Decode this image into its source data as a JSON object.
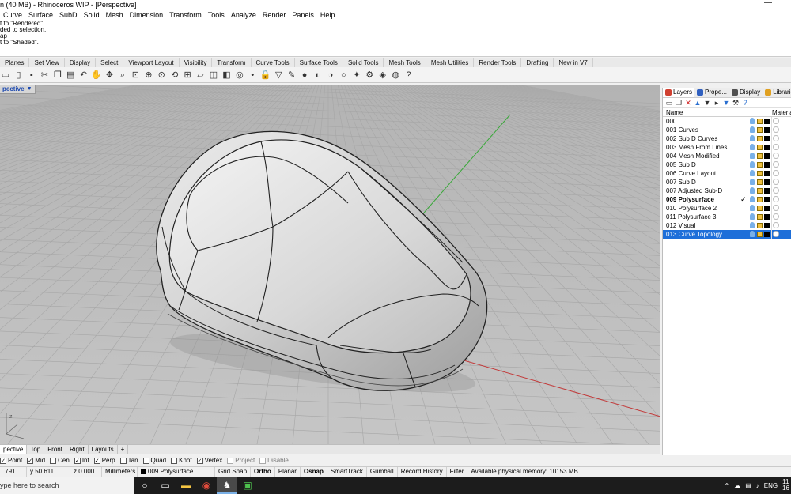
{
  "window": {
    "title": "n (40 MB) - Rhinoceros WIP - [Perspective]",
    "minimize": "—"
  },
  "menu": [
    "Curve",
    "Surface",
    "SubD",
    "Solid",
    "Mesh",
    "Dimension",
    "Transform",
    "Tools",
    "Analyze",
    "Render",
    "Panels",
    "Help"
  ],
  "command_history": [
    "t to \"Rendered\".",
    "ded to selection.",
    "ap",
    "t to \"Shaded\"."
  ],
  "toolbar_tabs": [
    "Planes",
    "Set View",
    "Display",
    "Select",
    "Viewport Layout",
    "Visibility",
    "Transform",
    "Curve Tools",
    "Surface Tools",
    "Solid Tools",
    "Mesh Tools",
    "Mesh Utilities",
    "Render Tools",
    "Drafting",
    "New in V7"
  ],
  "toolbar_icons": [
    "new-file-icon",
    "open-icon",
    "save-icon",
    "cut-icon",
    "copy-icon",
    "paste-icon",
    "undo-icon",
    "pan-icon",
    "move-view-icon",
    "zoom-icon",
    "zoom-window-icon",
    "zoom-extents-icon",
    "zoom-selected-icon",
    "rotate-view-icon",
    "four-views-icon",
    "plane-icon",
    "cplane-icon",
    "named-view-icon",
    "zoom-target-icon",
    "point-icon",
    "lock-icon",
    "select-filter-icon",
    "render-icon",
    "rendered-sphere-icon",
    "shaded-sphere-icon",
    "ghosted-sphere-icon",
    "xray-sphere-icon",
    "light-icon",
    "gear-settings-icon",
    "layers-icon",
    "globe-icon",
    "help-icon"
  ],
  "viewport": {
    "title": "pective",
    "tabs": [
      "pective",
      "Top",
      "Front",
      "Right",
      "Layouts",
      "+"
    ]
  },
  "osnaps": [
    {
      "label": "Point",
      "checked": true,
      "enabled": true
    },
    {
      "label": "Mid",
      "checked": true,
      "enabled": true
    },
    {
      "label": "Cen",
      "checked": false,
      "enabled": true
    },
    {
      "label": "Int",
      "checked": true,
      "enabled": true
    },
    {
      "label": "Perp",
      "checked": true,
      "enabled": true
    },
    {
      "label": "Tan",
      "checked": false,
      "enabled": true
    },
    {
      "label": "Quad",
      "checked": false,
      "enabled": true
    },
    {
      "label": "Knot",
      "checked": false,
      "enabled": true
    },
    {
      "label": "Vertex",
      "checked": true,
      "enabled": true
    },
    {
      "label": "Project",
      "checked": false,
      "enabled": false
    },
    {
      "label": "Disable",
      "checked": false,
      "enabled": false
    }
  ],
  "status": {
    "x": ".791",
    "y": "y 50.611",
    "z": "z 0.000",
    "units": "Millimeters",
    "layer": "009 Polysurface",
    "grid_snap": "Grid Snap",
    "ortho": "Ortho",
    "planar": "Planar",
    "osnap": "Osnap",
    "smarttrack": "SmartTrack",
    "gumball": "Gumball",
    "record_history": "Record History",
    "filter": "Filter",
    "memory": "Available physical memory: 10153 MB"
  },
  "taskbar": {
    "search_placeholder": "ype here to search",
    "apps": [
      "cortana-icon",
      "task-view-icon",
      "file-explorer-icon",
      "chrome-icon",
      "rhino-icon",
      "camtasia-icon"
    ],
    "tray_lang": "ENG",
    "tray_time": "11",
    "tray_date": "16"
  },
  "panel": {
    "tabs": [
      {
        "label": "Layers",
        "color": "#d04030"
      },
      {
        "label": "Prope...",
        "color": "#3060c0"
      },
      {
        "label": "Display",
        "color": "#505050"
      },
      {
        "label": "Libraries",
        "color": "#e0a020"
      }
    ],
    "tools": [
      "new-layer-icon",
      "new-sublayer-icon",
      "delete-layer-icon",
      "move-up-icon",
      "move-down-icon",
      "move-folder-icon",
      "filter-icon",
      "tools-icon",
      "help-icon"
    ],
    "col_name": "Name",
    "col_material": "Materia",
    "layers": [
      {
        "name": "000",
        "current": false,
        "selected": false
      },
      {
        "name": "001 Curves",
        "current": false,
        "selected": false
      },
      {
        "name": "002 Sub D Curves",
        "current": false,
        "selected": false
      },
      {
        "name": "003 Mesh From Lines",
        "current": false,
        "selected": false
      },
      {
        "name": "004 Mesh Modified",
        "current": false,
        "selected": false
      },
      {
        "name": "005 Sub D",
        "current": false,
        "selected": false
      },
      {
        "name": "006 Curve Layout",
        "current": false,
        "selected": false
      },
      {
        "name": "007 Sub D",
        "current": false,
        "selected": false
      },
      {
        "name": "007 Adjusted Sub-D",
        "current": false,
        "selected": false
      },
      {
        "name": "009 Polysurface",
        "current": true,
        "selected": false
      },
      {
        "name": "010 Polysurface 2",
        "current": false,
        "selected": false
      },
      {
        "name": "011 Polysurface 3",
        "current": false,
        "selected": false
      },
      {
        "name": "012 Visual",
        "current": false,
        "selected": false
      },
      {
        "name": "013 Curve Topology",
        "current": false,
        "selected": true
      }
    ],
    "current_mark": "✓"
  }
}
